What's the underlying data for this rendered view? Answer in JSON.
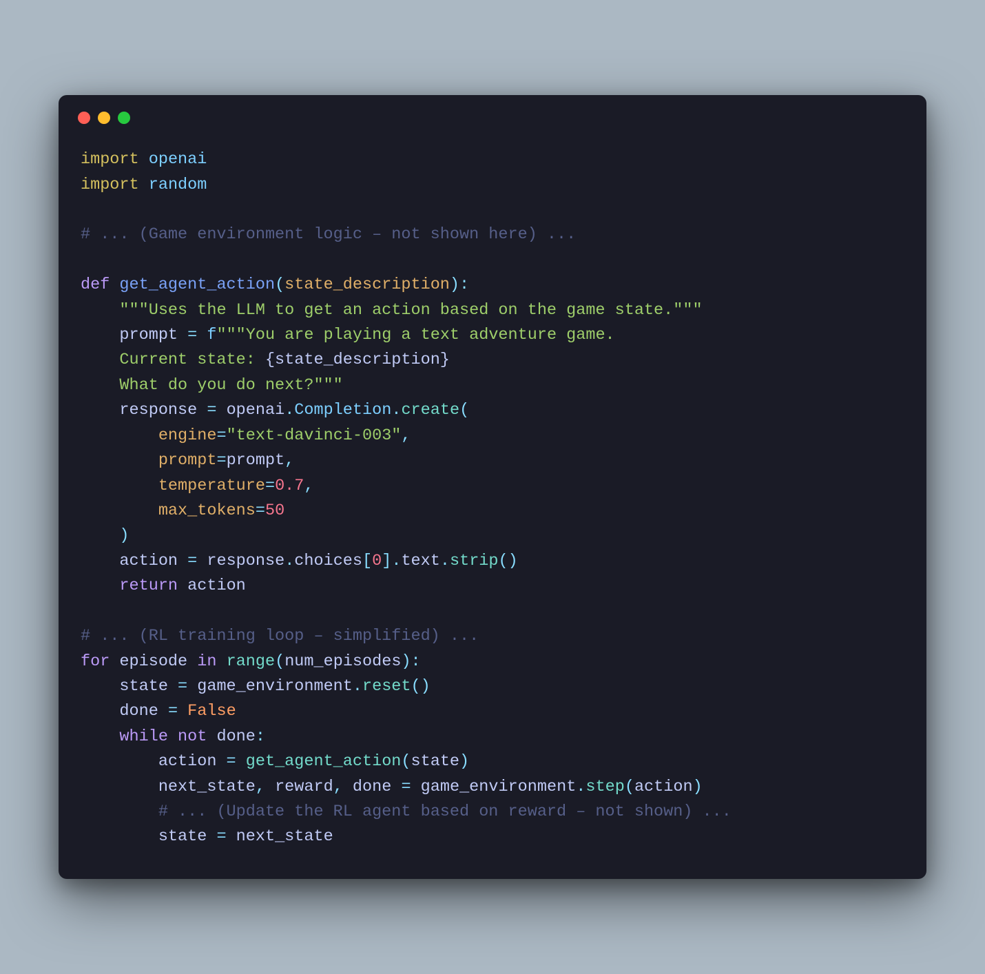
{
  "tokens": {
    "l1_import": "import",
    "l1_mod": "openai",
    "l2_import": "import",
    "l2_mod": "random",
    "l4_cmt": "# ... (Game environment logic – not shown here) ...",
    "l6_def": "def",
    "l6_fn": "get_agent_action",
    "l6_p": "(",
    "l6_arg": "state_description",
    "l6_p2": "):",
    "l7_doc": "\"\"\"Uses the LLM to get an action based on the game state.\"\"\"",
    "l8_p": "prompt",
    "l8_eq": " = ",
    "l8_f": "f",
    "l8_s": "\"\"\"You are playing a text adventure game.",
    "l9_s": "    Current state: ",
    "l9_br": "{state_description}",
    "l10_s": "    What do you do next?\"\"\"",
    "l11_r": "response",
    "l11_eq": " = ",
    "l11_o": "openai",
    "l11_d1": ".",
    "l11_c": "Completion",
    "l11_d2": ".",
    "l11_cr": "create",
    "l11_p": "(",
    "l12_k": "engine",
    "l12_eq": "=",
    "l12_v": "\"text-davinci-003\"",
    "l12_c": ",",
    "l13_k": "prompt",
    "l13_eq": "=",
    "l13_v": "prompt",
    "l13_c": ",",
    "l14_k": "temperature",
    "l14_eq": "=",
    "l14_v": "0.7",
    "l14_c": ",",
    "l15_k": "max_tokens",
    "l15_eq": "=",
    "l15_v": "50",
    "l16_p": ")",
    "l17_a": "action",
    "l17_eq": " = ",
    "l17_r": "response",
    "l17_d1": ".",
    "l17_ch": "choices",
    "l17_b1": "[",
    "l17_0": "0",
    "l17_b2": "]",
    "l17_d2": ".",
    "l17_tx": "text",
    "l17_d3": ".",
    "l17_st": "strip",
    "l17_p": "()",
    "l18_ret": "return",
    "l18_a": "action",
    "l20_cmt": "# ... (RL training loop – simplified) ...",
    "l21_for": "for",
    "l21_ep": "episode",
    "l21_in": "in",
    "l21_rng": "range",
    "l21_p1": "(",
    "l21_ne": "num_episodes",
    "l21_p2": "):",
    "l22_st": "state",
    "l22_eq": " = ",
    "l22_ge": "game_environment",
    "l22_d": ".",
    "l22_rs": "reset",
    "l22_p": "()",
    "l23_d": "done",
    "l23_eq": " = ",
    "l23_f": "False",
    "l24_wh": "while",
    "l24_not": "not",
    "l24_d": "done",
    "l24_c": ":",
    "l25_a": "action",
    "l25_eq": " = ",
    "l25_fn": "get_agent_action",
    "l25_p1": "(",
    "l25_st": "state",
    "l25_p2": ")",
    "l26_ns": "next_state",
    "l26_c1": ", ",
    "l26_rw": "reward",
    "l26_c2": ", ",
    "l26_d": "done",
    "l26_eq": " = ",
    "l26_ge": "game_environment",
    "l26_dot": ".",
    "l26_st": "step",
    "l26_p1": "(",
    "l26_ac": "action",
    "l26_p2": ")",
    "l27_cmt": "# ... (Update the RL agent based on reward – not shown) ...",
    "l28_st": "state",
    "l28_eq": " = ",
    "l28_ns": "next_state"
  }
}
